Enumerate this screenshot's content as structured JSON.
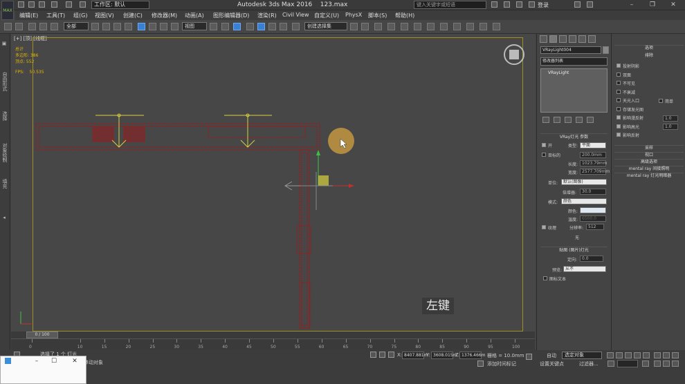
{
  "titlebar": {
    "logo": "MAX",
    "workspace": "工作区: 默认",
    "title": "Autodesk 3ds Max 2016",
    "filename": "123.max",
    "search_placeholder": "键入关键字或短语",
    "login": "登录"
  },
  "menu": [
    "编辑(E)",
    "工具(T)",
    "组(G)",
    "视图(V)",
    "创建(C)",
    "修改器(M)",
    "动画(A)",
    "图形编辑器(D)",
    "渲染(R)",
    "Civil View",
    "自定义(U)",
    "PhysX",
    "脚本(S)",
    "帮助(H)"
  ],
  "toolbar": {
    "filter": "全部",
    "ref_coord": "视图",
    "selection_set": "创建选择集"
  },
  "left_tabs": [
    "自由形式",
    "选择",
    "对象绘制",
    "填充"
  ],
  "viewport": {
    "label": "[+] [顶] [线框]",
    "stats": [
      "总计",
      "多边形: 386",
      "顶点: 552"
    ],
    "fps_label": "FPS:",
    "fps_value": "50.535",
    "caption": "左键"
  },
  "timeline": {
    "frame": "0 / 100",
    "ticks": [
      "0",
      "10",
      "15",
      "20",
      "25",
      "30",
      "35",
      "40",
      "45",
      "50",
      "55",
      "60",
      "65",
      "70",
      "75",
      "80",
      "85",
      "90",
      "95",
      "100"
    ]
  },
  "status": {
    "selected": "选择了 1 个 灯光",
    "prompt": "单击并拖动以选择并移动对象",
    "x": "8407.881m",
    "y": "3608.015m",
    "z": "1376.466m",
    "grid": "栅格 = 10.0mm",
    "add_time_tag": "添加时间标记",
    "auto": "自动",
    "auto_select": "选定对象",
    "set_key": "设置关键点",
    "filter": "过滤器..."
  },
  "command_panel": {
    "object_name": "VRayLight004",
    "modifier_list": "修改器列表",
    "stack_item": "VRayLight",
    "vray_params_header": "VRay灯光 参数",
    "on": "开",
    "type_label": "类型:",
    "type_value": "平面",
    "target_label": "目标的",
    "target_value": "200.0mm",
    "length_label": "长度:",
    "length_value": "1023.79mm",
    "width_label": "宽度:",
    "width_value": "2577.709mm",
    "units_label": "单位:",
    "units_value": "默认(图像)",
    "multiplier_label": "倍增器:",
    "multiplier_value": "30.0",
    "mode_label": "模式:",
    "mode_value": "颜色",
    "color_label": "颜色:",
    "temp_label": "温度:",
    "temp_value": "6500.0",
    "texture_label": "纹理",
    "resolution_label": "分辨率:",
    "resolution_value": "512",
    "none": "无",
    "photometric_header": "贴图 (图片)灯光",
    "direction_label": "定向:",
    "direction_value": "0.0",
    "preview_label": "预览:",
    "preview_value": "从不",
    "icon_label": "图标文本"
  },
  "options_panel": {
    "header": "选项",
    "exclude": "排除",
    "options": [
      "投射阴影",
      "双面",
      "不可见",
      "不衰减",
      "天光入口",
      "存储发光图",
      "影响漫反射",
      "影响高光",
      "影响反射"
    ],
    "simple_label": "简单",
    "diffuse_value": "1.0",
    "specular_value": "1.0",
    "sampling": "采样",
    "viewport": "视口",
    "advanced": "高级选项",
    "mr_indirect": "mental ray 间接照明",
    "mr_light_shader": "mental ray 灯光明暗器"
  },
  "colors": {
    "selection_yellow": "#a09020",
    "wireframe_red": "#a01818",
    "light_yellow": "#d8d040"
  }
}
